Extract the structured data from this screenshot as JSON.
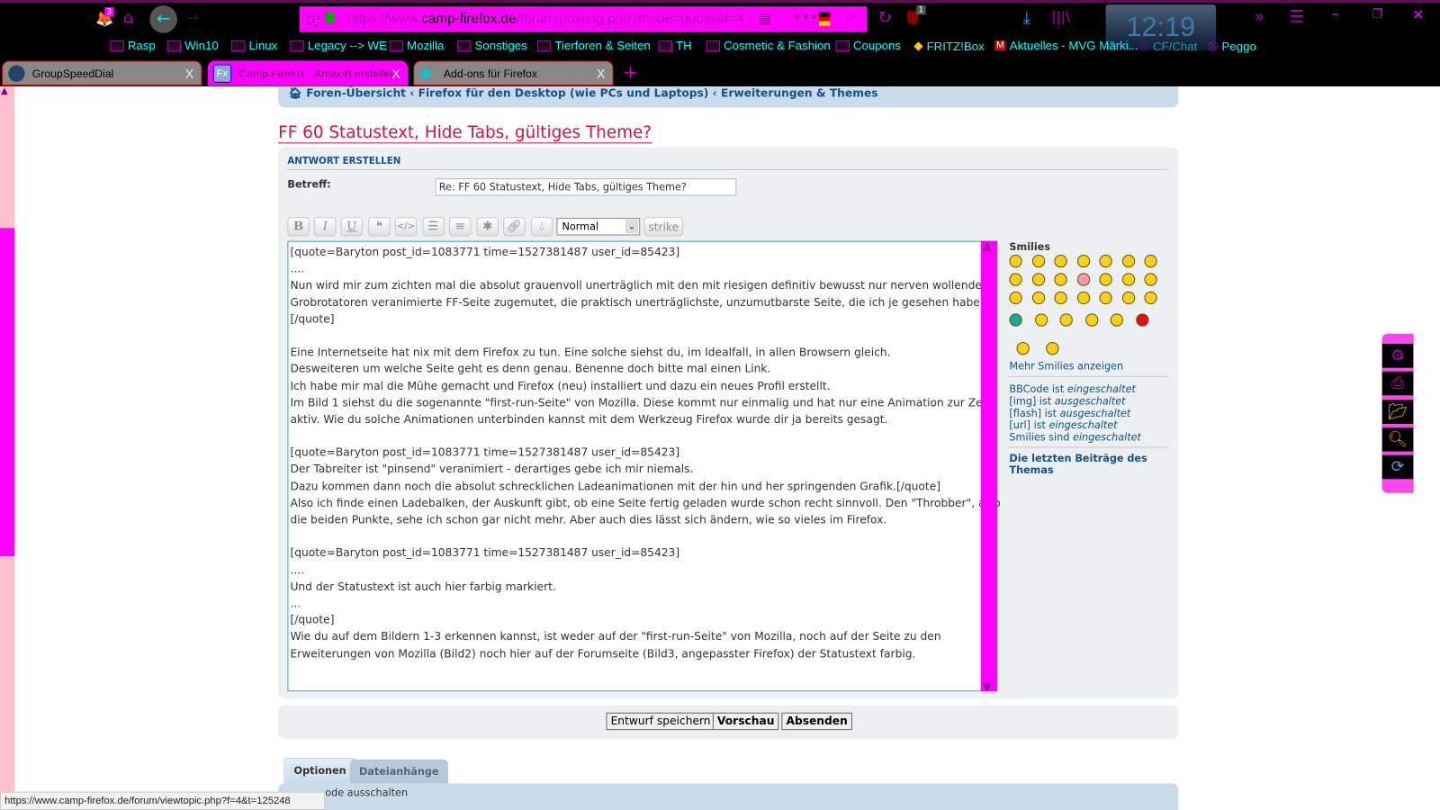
{
  "browser": {
    "notif_count": "3",
    "url_prefix": "https://www.",
    "url_domain": "camp-firefox.de",
    "url_rest": "/forum/posting.php?mode=quote&f=4",
    "ublock_count": "1",
    "clock": "12:19",
    "bookmarks": [
      "Rasp",
      "Win10",
      "Linux",
      "Legacy --> WE",
      "Mozilla",
      "Sonstiges",
      "Tierforen & Seiten",
      "TH",
      "Cosmetic & Fashion",
      "Coupons",
      "FRITZ!Box",
      "Aktuelles - MVG Märki...",
      "CF/Chat",
      "Peggo"
    ],
    "tabs": [
      {
        "label": "GroupSpeedDial"
      },
      {
        "label": "Camp Firefox - Antwort erstellen"
      },
      {
        "label": "Add-ons für Firefox"
      }
    ],
    "close_glyph": "X",
    "new_tab_glyph": "+",
    "status_url": "https://www.camp-firefox.de/forum/viewtopic.php?f=4&t=125248"
  },
  "breadcrumb": [
    "Foren-Übersicht",
    "Firefox für den Desktop (wie PCs und Laptops)",
    "Erweiterungen & Themes"
  ],
  "page": {
    "title": "FF 60 Statustext, Hide Tabs, gültiges Theme?",
    "section": "ANTWORT ERSTELLEN",
    "subject_label": "Betreff:",
    "subject_value": "Re: FF 60 Statustext, Hide Tabs, gültiges Theme?",
    "toolbar": {
      "bold": "B",
      "italic": "I",
      "underline": "U",
      "font_size": "Normal",
      "strike": "strike"
    },
    "lines": [
      "[quote=Baryton post_id=1083771 time=1527381487 user_id=85423]",
      "....",
      "Nun wird mir zum zichten mal die absolut grauenvoll unerträglich mit den mit riesigen definitiv bewusst nur nerven wollenden",
      "Grobrotatoren veranimierte FF-Seite zugemutet, die praktisch unerträglichste, unzumutbarste Seite, die ich je gesehen habe.",
      "[/quote]",
      "",
      "Eine Internetseite hat nix mit dem Firefox zu tun. Eine solche siehst du, im Idealfall, in allen Browsern gleich.",
      "Desweiteren um welche Seite geht es denn genau. Benenne doch bitte mal einen Link.",
      "Ich habe mir mal die Mühe gemacht und Firefox (neu) installiert und dazu ein neues Profil erstellt.",
      "Im Bild 1 siehst du die sogenannte \"first-run-Seite\" von Mozilla. Diese kommt nur einmalig und hat nur eine Animation zur Zeit",
      "aktiv. Wie du solche Animationen unterbinden kannst mit dem Werkzeug Firefox wurde dir ja bereits gesagt.",
      "",
      "[quote=Baryton post_id=1083771 time=1527381487 user_id=85423]",
      "Der Tabreiter ist \"pinsend\" veranimiert - derartiges gebe ich mir niemals.",
      "Dazu kommen dann noch die absolut schrecklichen Ladeanimationen mit der hin und her springenden Grafik.[/quote]",
      "Also ich finde einen Ladebalken, der Auskunft gibt, ob eine Seite fertig geladen wurde schon recht sinnvoll. Den \"Throbber\", also",
      "die beiden Punkte, sehe ich schon gar nicht mehr. Aber auch dies lässt sich ändern, wie so vieles im Firefox.",
      "",
      "[quote=Baryton post_id=1083771 time=1527381487 user_id=85423]",
      "....",
      "Und der Statustext ist auch hier farbig markiert.",
      "...",
      "[/quote]",
      "Wie du auf dem Bildern 1-3 erkennen kannst, ist weder auf der \"first-run-Seite\" von Mozilla, noch auf der Seite zu den",
      "Erweiterungen von Mozilla (Bild2) noch hier auf der Forumseite (Bild3, angepasster Firefox) der Statustext farbig."
    ],
    "smilies_title": "Smilies",
    "more_smilies": "Mehr Smilies anzeigen",
    "status": [
      {
        "pre": "BBCode ist ",
        "em": "eingeschaltet"
      },
      {
        "pre": "[img] ist ",
        "em": "ausgeschaltet"
      },
      {
        "pre": "[flash] ist ",
        "em": "ausgeschaltet"
      },
      {
        "pre": "[url] ist ",
        "em": "eingeschaltet"
      },
      {
        "pre": "Smilies sind ",
        "em": "eingeschaltet"
      }
    ],
    "recent_posts": "Die letzten Beiträge des Themas",
    "buttons": {
      "draft": "Entwurf speichern",
      "preview": "Vorschau",
      "submit": "Absenden"
    },
    "tabs": {
      "options": "Optionen",
      "attachments": "Dateianhänge"
    },
    "options_partial": "ode ausschalten"
  },
  "colors": {
    "accent": "#ff00ff",
    "link": "#105289",
    "title": "#d31141"
  }
}
